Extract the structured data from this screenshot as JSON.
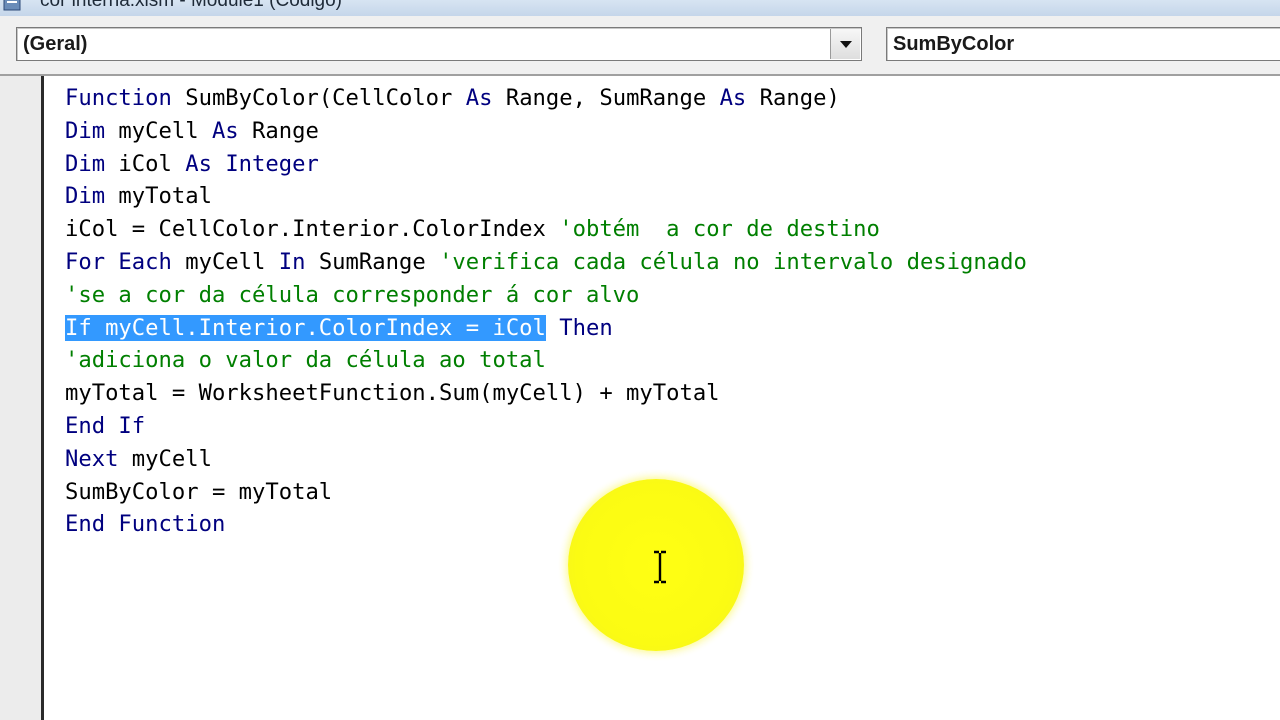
{
  "window": {
    "title": "cor interna.xlsm - Module1 (Código)"
  },
  "toolbar": {
    "object_combo": {
      "value": "(Geral)"
    },
    "procedure_combo": {
      "value": "SumByColor"
    }
  },
  "colors": {
    "keyword": "#00007f",
    "comment": "#007f00",
    "selection": "#3399ff",
    "highlight": "#ffff00"
  },
  "code": {
    "lines": [
      [
        {
          "t": "kw",
          "s": "Function"
        },
        {
          "t": "tx",
          "s": " SumByColor(CellColor "
        },
        {
          "t": "kw",
          "s": "As"
        },
        {
          "t": "tx",
          "s": " Range, SumRange "
        },
        {
          "t": "kw",
          "s": "As"
        },
        {
          "t": "tx",
          "s": " Range)"
        }
      ],
      [
        {
          "t": "kw",
          "s": "Dim"
        },
        {
          "t": "tx",
          "s": " myCell "
        },
        {
          "t": "kw",
          "s": "As"
        },
        {
          "t": "tx",
          "s": " Range"
        }
      ],
      [
        {
          "t": "kw",
          "s": "Dim"
        },
        {
          "t": "tx",
          "s": " iCol "
        },
        {
          "t": "kw",
          "s": "As"
        },
        {
          "t": "tx",
          "s": " "
        },
        {
          "t": "kw",
          "s": "Integer"
        }
      ],
      [
        {
          "t": "kw",
          "s": "Dim"
        },
        {
          "t": "tx",
          "s": " myTotal"
        }
      ],
      [
        {
          "t": "tx",
          "s": "iCol = CellColor.Interior.ColorIndex "
        },
        {
          "t": "cm",
          "s": "'obtém  a cor de destino"
        }
      ],
      [
        {
          "t": "kw",
          "s": "For Each"
        },
        {
          "t": "tx",
          "s": " myCell "
        },
        {
          "t": "kw",
          "s": "In"
        },
        {
          "t": "tx",
          "s": " SumRange "
        },
        {
          "t": "cm",
          "s": "'verifica cada célula no intervalo designado"
        }
      ],
      [
        {
          "t": "cm",
          "s": "'se a cor da célula corresponder á cor alvo"
        }
      ],
      [
        {
          "t": "sel",
          "s": "If myCell.Interior.ColorIndex = iCol"
        },
        {
          "t": "tx",
          "s": " "
        },
        {
          "t": "kw",
          "s": "Then"
        }
      ],
      [
        {
          "t": "cm",
          "s": "'adiciona o valor da célula ao total"
        }
      ],
      [
        {
          "t": "tx",
          "s": "myTotal = WorksheetFunction.Sum(myCell) + myTotal"
        }
      ],
      [
        {
          "t": "kw",
          "s": "End If"
        }
      ],
      [
        {
          "t": "kw",
          "s": "Next"
        },
        {
          "t": "tx",
          "s": " myCell"
        }
      ],
      [
        {
          "t": "tx",
          "s": "SumByColor = myTotal"
        }
      ],
      [
        {
          "t": "kw",
          "s": "End Function"
        }
      ]
    ]
  },
  "icons": {
    "dropdown": "chevron-down-icon",
    "cursor": "text-cursor-icon"
  }
}
